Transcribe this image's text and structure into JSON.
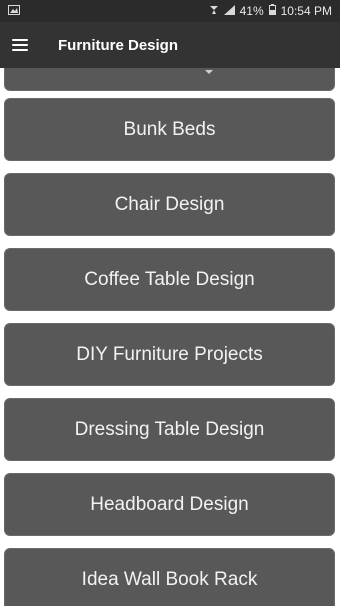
{
  "status_bar": {
    "battery": "41%",
    "time": "10:54 PM"
  },
  "app_bar": {
    "title": "Furniture Design",
    "menu_icon": "hamburger-menu-icon"
  },
  "list": {
    "items": [
      {
        "label": "Bunk Beds"
      },
      {
        "label": "Chair Design"
      },
      {
        "label": "Coffee Table Design"
      },
      {
        "label": "DIY Furniture Projects"
      },
      {
        "label": "Dressing Table Design"
      },
      {
        "label": "Headboard Design"
      },
      {
        "label": "Idea Wall Book Rack"
      }
    ]
  },
  "colors": {
    "status_bar_bg": "#2b2b2b",
    "app_bar_bg": "#333333",
    "item_bg": "#585858",
    "item_text": "#f2f2f2"
  }
}
